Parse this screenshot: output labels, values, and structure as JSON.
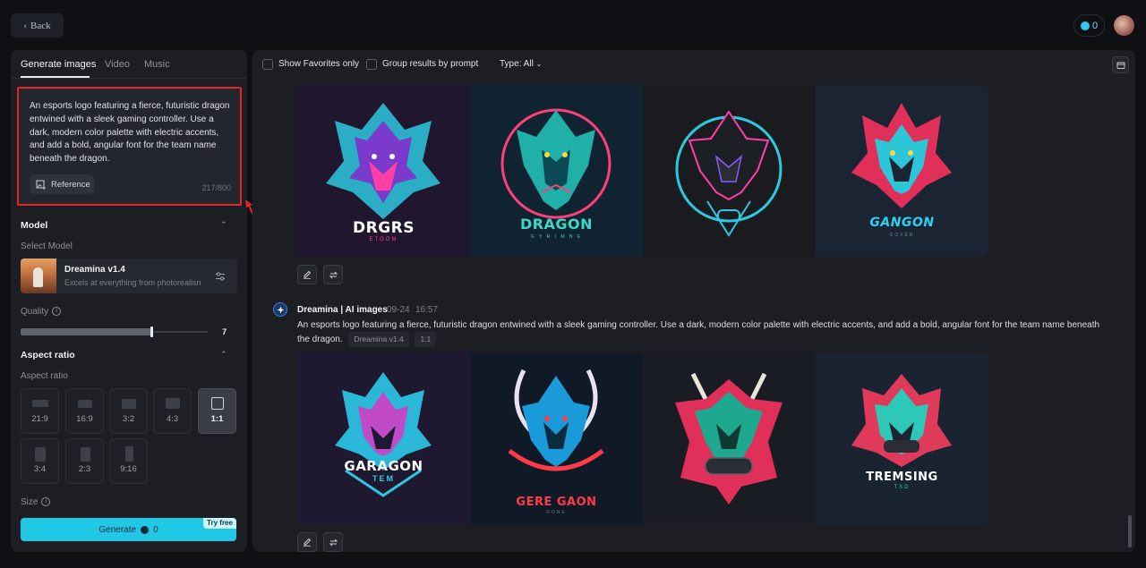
{
  "topbar": {
    "back_label": "Back",
    "credits": "0"
  },
  "left": {
    "tabs": [
      "Generate images",
      "Video",
      "Music"
    ],
    "prompt": "An esports logo featuring a fierce, futuristic dragon entwined with a sleek gaming controller. Use a dark, modern color palette with electric accents, and add a bold, angular font for the team name beneath the dragon.",
    "reference_label": "Reference",
    "counter": "217/800",
    "model_section": "Model",
    "select_model_label": "Select Model",
    "model_name": "Dreamina v1.4",
    "model_desc": "Excels at everything from photorealism to...",
    "quality_label": "Quality",
    "quality_value": "7",
    "quality_fraction": 0.7,
    "aspect_section": "Aspect ratio",
    "aspect_label": "Aspect ratio",
    "aspect_ratios": [
      "21:9",
      "16:9",
      "3:2",
      "4:3",
      "1:1",
      "3:4",
      "2:3",
      "9:16"
    ],
    "aspect_selected": "1:1",
    "size_label": "Size",
    "generate_label": "Generate",
    "generate_cost": "0",
    "try_free": "Try free"
  },
  "main": {
    "favorites_label": "Show Favorites only",
    "group_label": "Group results by prompt",
    "type_label": "Type: All",
    "row1_texts": [
      {
        "main": "DRGRS",
        "sub": "ETOOM",
        "color": "#ffffff"
      },
      {
        "main": "DRAGON",
        "sub": "G Y R I M N E",
        "color": "#3fd6c8"
      },
      {
        "main": "",
        "sub": "",
        "color": "#ffffff"
      },
      {
        "main": "GANGON",
        "sub": "GOXER",
        "color": "#2fd0f0"
      }
    ],
    "gen_title": "Dreamina | AI images",
    "gen_date": "09-24",
    "gen_time": "16:57",
    "gen_prompt": "An esports logo featuring a fierce, futuristic dragon entwined with a sleek gaming controller. Use a dark, modern color palette with electric accents, and add a bold, angular font for the team name beneath the dragon.",
    "gen_tag_model": "Dreamina v1.4",
    "gen_tag_ratio": "1:1",
    "row2_texts": [
      {
        "main": "GARAGON",
        "sub": "TEM",
        "color": "#ffffff"
      },
      {
        "main": "GERE GAON",
        "sub": "GONE",
        "color": "#ff3a4a"
      },
      {
        "main": "",
        "sub": "",
        "color": "#ffffff"
      },
      {
        "main": "TREMSING",
        "sub": "TSD",
        "color": "#ffffff"
      }
    ]
  },
  "colors": {
    "accent": "#21c8e6",
    "highlight_border": "#e02828",
    "panel": "#1c1e23",
    "background": "#0f1013"
  }
}
